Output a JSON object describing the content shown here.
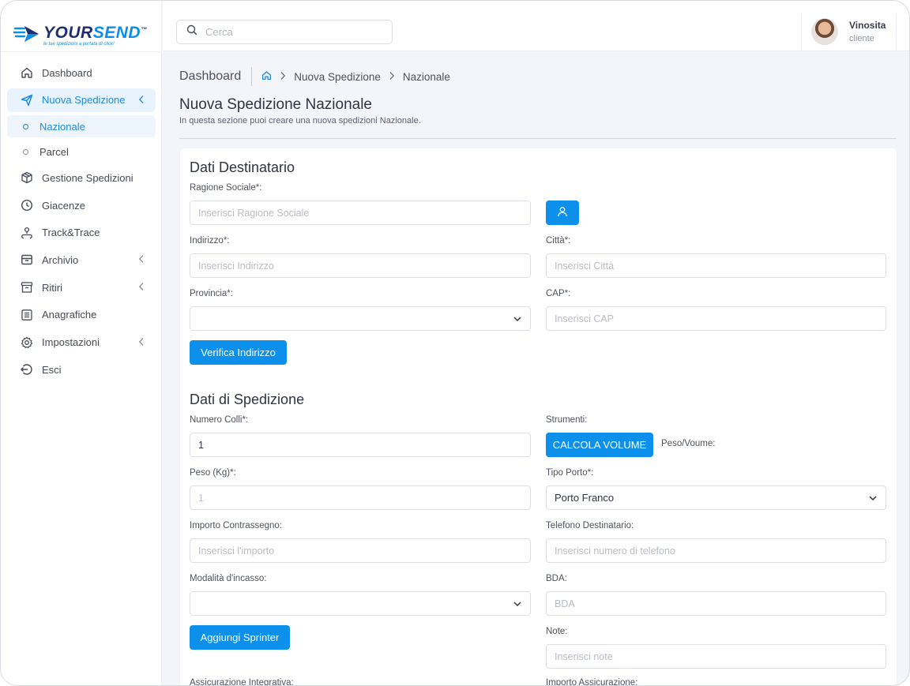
{
  "brand": {
    "name_a": "YOUR",
    "name_b": "SEND",
    "tm": "™",
    "tagline": "le tue spedizioni a portata di click!"
  },
  "sidebar": {
    "items": [
      {
        "label": "Dashboard",
        "icon": "home-icon"
      },
      {
        "label": "Nuova Spedizione",
        "icon": "send-icon",
        "active": true
      },
      {
        "label": "Gestione Spedizioni",
        "icon": "box-icon"
      },
      {
        "label": "Giacenze",
        "icon": "clock-icon"
      },
      {
        "label": "Track&Trace",
        "icon": "route-icon"
      },
      {
        "label": "Archivio",
        "icon": "archive-icon"
      },
      {
        "label": "Ritiri",
        "icon": "inbox-icon"
      },
      {
        "label": "Anagrafiche",
        "icon": "list-icon"
      },
      {
        "label": "Impostazioni",
        "icon": "gear-icon"
      },
      {
        "label": "Esci",
        "icon": "logout-icon"
      }
    ],
    "subitems": [
      {
        "label": "Nazionale",
        "active": true
      },
      {
        "label": "Parcel"
      }
    ]
  },
  "topbar": {
    "search_placeholder": "Cerca",
    "user_name": "Vinosita",
    "user_role": "cliente"
  },
  "breadcrumb": {
    "title": "Dashboard",
    "items": [
      "Nuova Spedizione",
      "Nazionale"
    ]
  },
  "page": {
    "title": "Nuova Spedizione Nazionale",
    "subtitle": "In questa sezione puoi creare una nuova spedizioni Nazionale."
  },
  "destinatario": {
    "title": "Dati Destinatario",
    "ragione_label": "Ragione Sociale*:",
    "ragione_ph": "Inserisci Ragione Sociale",
    "indirizzo_label": "Indirizzo*:",
    "indirizzo_ph": "Inserisci Indirizzo",
    "citta_label": "Città*:",
    "citta_ph": "Inserisci Città",
    "provincia_label": "Provincia*:",
    "provincia_value": "",
    "cap_label": "CAP*:",
    "cap_ph": "Inserisci CAP",
    "verifica_btn": "Verifica Indirizzo"
  },
  "spedizione": {
    "title": "Dati di Spedizione",
    "colli_label": "Numero Colli*:",
    "colli_value": "1",
    "strumenti_label": "Strumenti:",
    "calcola_btn": "CALCOLA VOLUME",
    "peso_volume_label": "Peso/Voume:",
    "peso_label": "Peso (Kg)*:",
    "peso_ph": "1",
    "porto_label": "Tipo Porto*:",
    "porto_value": "Porto Franco",
    "contrassegno_label": "Importo Contrassegno:",
    "contrassegno_ph": "Inserisci l'importo",
    "telefono_label": "Telefono Destinatario:",
    "telefono_ph": "Inserisci numero di telefono",
    "incasso_label": "Modalità d'incasso:",
    "incasso_value": "",
    "bda_label": "BDA:",
    "bda_ph": "BDA",
    "sprinter_btn": "Aggiungi Sprinter",
    "note_label": "Note:",
    "note_ph": "Inserisci note",
    "assicurazione_label": "Assicurazione Integrativa:",
    "importo_assicurazione_label": "Importo Assicurazione:"
  }
}
